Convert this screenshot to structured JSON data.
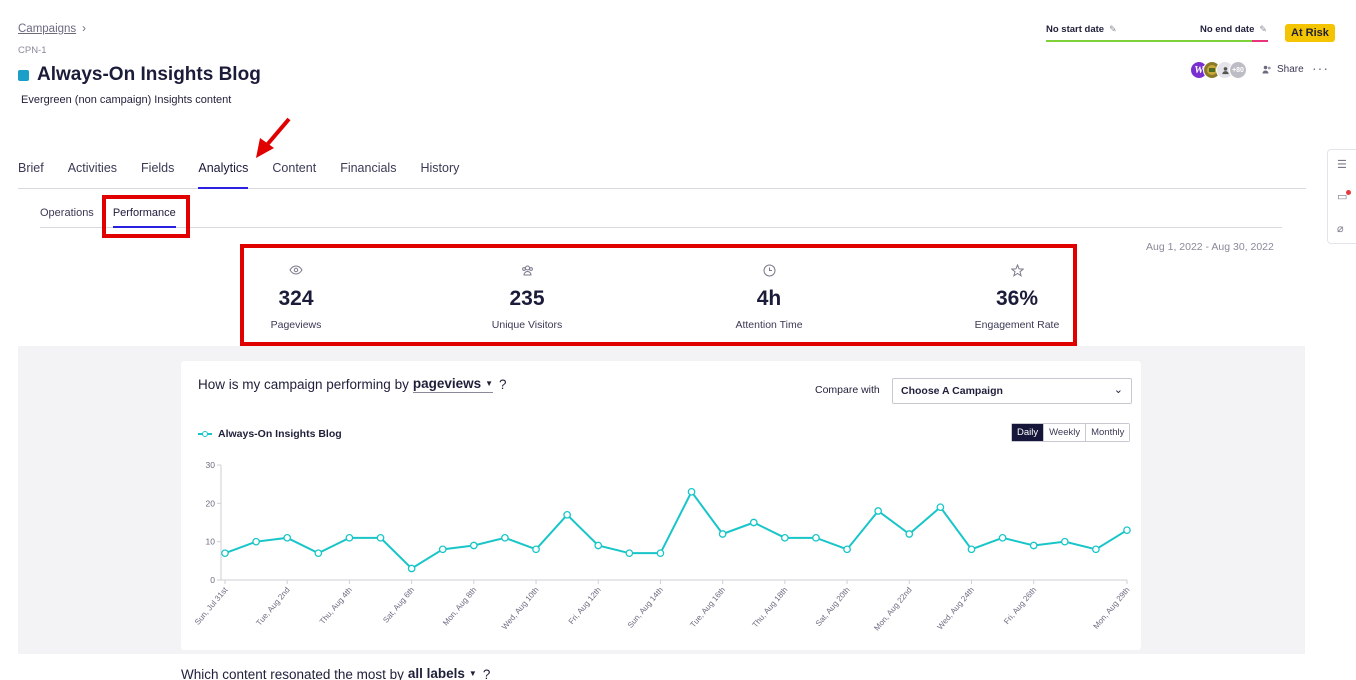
{
  "breadcrumb": {
    "parent": "Campaigns",
    "separator": "›"
  },
  "campaign": {
    "code": "CPN-1",
    "title": "Always-On Insights Blog",
    "description": "Evergreen (non campaign) Insights content",
    "color": "#1aa0c8"
  },
  "dates": {
    "start": "No start date",
    "end": "No end date"
  },
  "status": {
    "label": "At Risk",
    "color": "#f5c400"
  },
  "collaborators": {
    "avatar1": "W",
    "extra_count": "+80",
    "share_label": "Share",
    "more_label": "···"
  },
  "tabs": [
    "Brief",
    "Activities",
    "Fields",
    "Analytics",
    "Content",
    "Financials",
    "History"
  ],
  "active_tab": "Analytics",
  "subtabs": [
    "Operations",
    "Performance"
  ],
  "active_subtab": "Performance",
  "date_range": "Aug 1, 2022 - Aug 30, 2022",
  "stats": [
    {
      "icon": "eye-icon",
      "value": "324",
      "label": "Pageviews"
    },
    {
      "icon": "visitors-icon",
      "value": "235",
      "label": "Unique Visitors"
    },
    {
      "icon": "clock-icon",
      "value": "4h",
      "label": "Attention Time"
    },
    {
      "icon": "star-icon",
      "value": "36%",
      "label": "Engagement Rate"
    }
  ],
  "performance": {
    "question_prefix": "How is my campaign performing by",
    "metric": "pageviews",
    "question_suffix": "?",
    "compare_label": "Compare with",
    "compare_value": "Choose A Campaign",
    "periods": [
      "Daily",
      "Weekly",
      "Monthly"
    ],
    "active_period": "Daily"
  },
  "chart_data": {
    "type": "line",
    "series": [
      {
        "name": "Always-On Insights Blog",
        "color": "#18c5c8",
        "values": [
          7,
          10,
          11,
          7,
          11,
          11,
          3,
          8,
          9,
          11,
          8,
          17,
          9,
          7,
          7,
          23,
          12,
          15,
          11,
          11,
          8,
          18,
          12,
          19,
          8,
          11,
          9,
          10,
          8,
          13
        ]
      }
    ],
    "x": [
      "Sun, Jul 31st",
      "Mon, Aug 1st",
      "Tue, Aug 2nd",
      "Wed, Aug 3rd",
      "Thu, Aug 4th",
      "Fri, Aug 5th",
      "Sat, Aug 6th",
      "Sun, Aug 7th",
      "Mon, Aug 8th",
      "Tue, Aug 9th",
      "Wed, Aug 10th",
      "Thu, Aug 11th",
      "Fri, Aug 12th",
      "Sat, Aug 13th",
      "Sun, Aug 14th",
      "Mon, Aug 15th",
      "Tue, Aug 16th",
      "Wed, Aug 17th",
      "Thu, Aug 18th",
      "Fri, Aug 19th",
      "Sat, Aug 20th",
      "Sun, Aug 21st",
      "Mon, Aug 22nd",
      "Tue, Aug 23rd",
      "Wed, Aug 24th",
      "Thu, Aug 25th",
      "Fri, Aug 26th",
      "Sat, Aug 27th",
      "Sun, Aug 28th",
      "Mon, Aug 29th"
    ],
    "x_tick_labels": [
      "Sun, Jul 31st",
      "Tue, Aug 2nd",
      "Thu, Aug 4th",
      "Sat, Aug 6th",
      "Mon, Aug 8th",
      "Wed, Aug 10th",
      "Fri, Aug 12th",
      "Sun, Aug 14th",
      "Tue, Aug 16th",
      "Thu, Aug 18th",
      "Sat, Aug 20th",
      "Mon, Aug 22nd",
      "Wed, Aug 24th",
      "Fri, Aug 26th",
      "Mon, Aug 29th"
    ],
    "y_ticks": [
      0,
      10,
      20,
      30
    ],
    "ylim": [
      0,
      30
    ],
    "grid": false,
    "legend": "top-left"
  },
  "content_question": {
    "prefix": "Which content resonated the most by",
    "label": "all labels",
    "suffix": "?"
  }
}
